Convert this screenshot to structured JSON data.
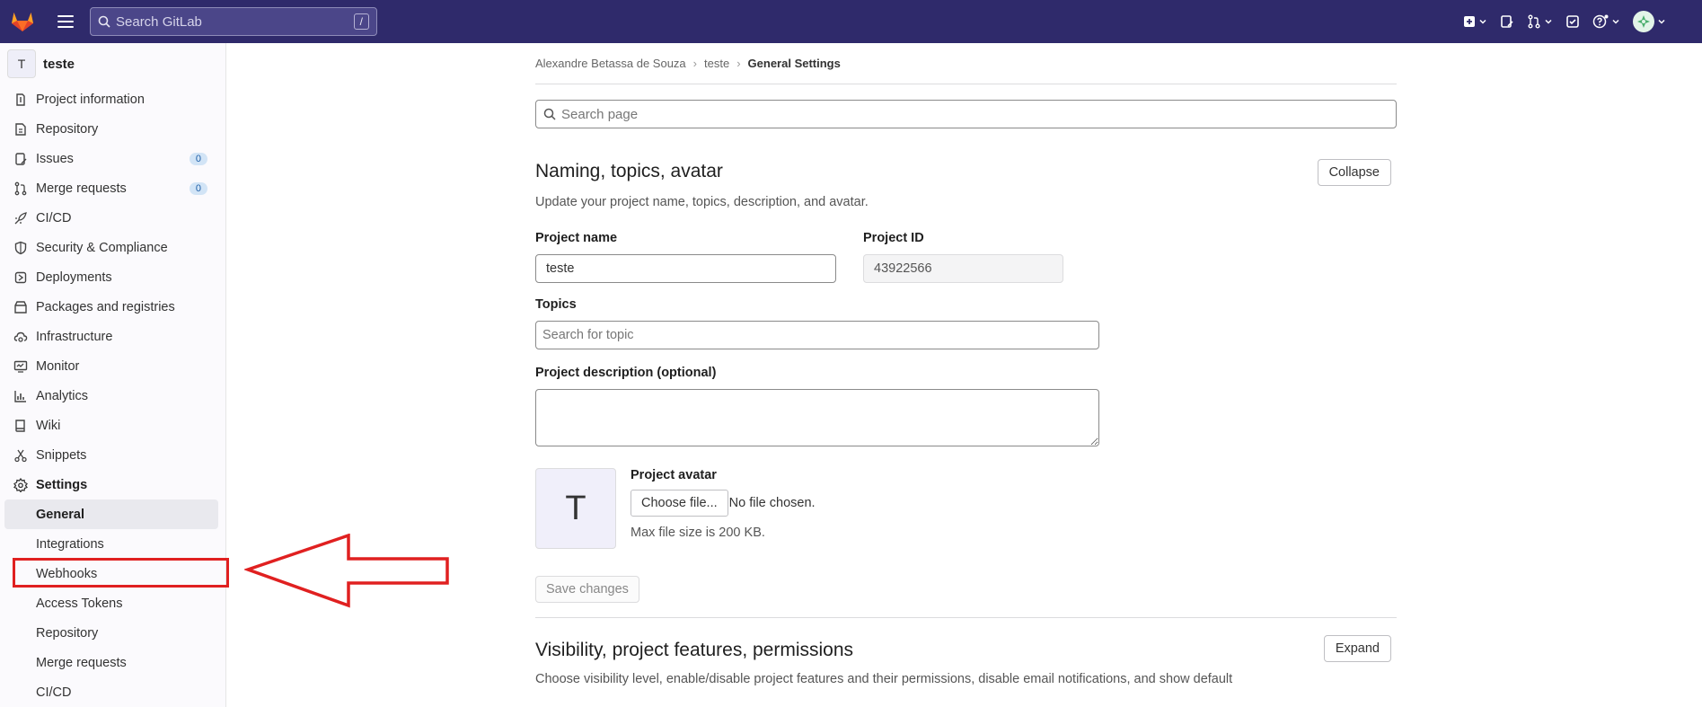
{
  "topbar": {
    "search_placeholder": "Search GitLab",
    "search_shortcut": "/"
  },
  "sidebar": {
    "project_initial": "T",
    "project_name": "teste",
    "items": [
      {
        "label": "Project information",
        "icon": "info-doc-icon"
      },
      {
        "label": "Repository",
        "icon": "doc-code-icon"
      },
      {
        "label": "Issues",
        "icon": "issues-icon",
        "badge": "0"
      },
      {
        "label": "Merge requests",
        "icon": "merge-request-icon",
        "badge": "0"
      },
      {
        "label": "CI/CD",
        "icon": "rocket-icon"
      },
      {
        "label": "Security & Compliance",
        "icon": "shield-icon"
      },
      {
        "label": "Deployments",
        "icon": "deployments-icon"
      },
      {
        "label": "Packages and registries",
        "icon": "package-icon"
      },
      {
        "label": "Infrastructure",
        "icon": "cloud-gear-icon"
      },
      {
        "label": "Monitor",
        "icon": "monitor-icon"
      },
      {
        "label": "Analytics",
        "icon": "chart-icon"
      },
      {
        "label": "Wiki",
        "icon": "book-icon"
      },
      {
        "label": "Snippets",
        "icon": "scissors-icon"
      },
      {
        "label": "Settings",
        "icon": "gear-icon"
      }
    ],
    "settings_sub": [
      {
        "label": "General",
        "active": true
      },
      {
        "label": "Integrations"
      },
      {
        "label": "Webhooks",
        "highlighted": true
      },
      {
        "label": "Access Tokens"
      },
      {
        "label": "Repository"
      },
      {
        "label": "Merge requests"
      },
      {
        "label": "CI/CD"
      }
    ]
  },
  "breadcrumb": {
    "items": [
      "Alexandre Betassa de Souza",
      "teste",
      "General Settings"
    ]
  },
  "search_page_placeholder": "Search page",
  "section1": {
    "title": "Naming, topics, avatar",
    "description": "Update your project name, topics, description, and avatar.",
    "collapse_label": "Collapse",
    "project_name_label": "Project name",
    "project_name_value": "teste",
    "project_id_label": "Project ID",
    "project_id_value": "43922566",
    "topics_label": "Topics",
    "topics_placeholder": "Search for topic",
    "description_label": "Project description (optional)",
    "avatar_label": "Project avatar",
    "avatar_initial": "T",
    "choose_file_label": "Choose file...",
    "no_file_text": "No file chosen.",
    "max_size_text": "Max file size is 200 KB.",
    "save_label": "Save changes"
  },
  "section2": {
    "title": "Visibility, project features, permissions",
    "description": "Choose visibility level, enable/disable project features and their permissions, disable email notifications, and show default",
    "expand_label": "Expand"
  },
  "colors": {
    "topbar": "#2f2a6b",
    "annotation": "#e02020"
  }
}
